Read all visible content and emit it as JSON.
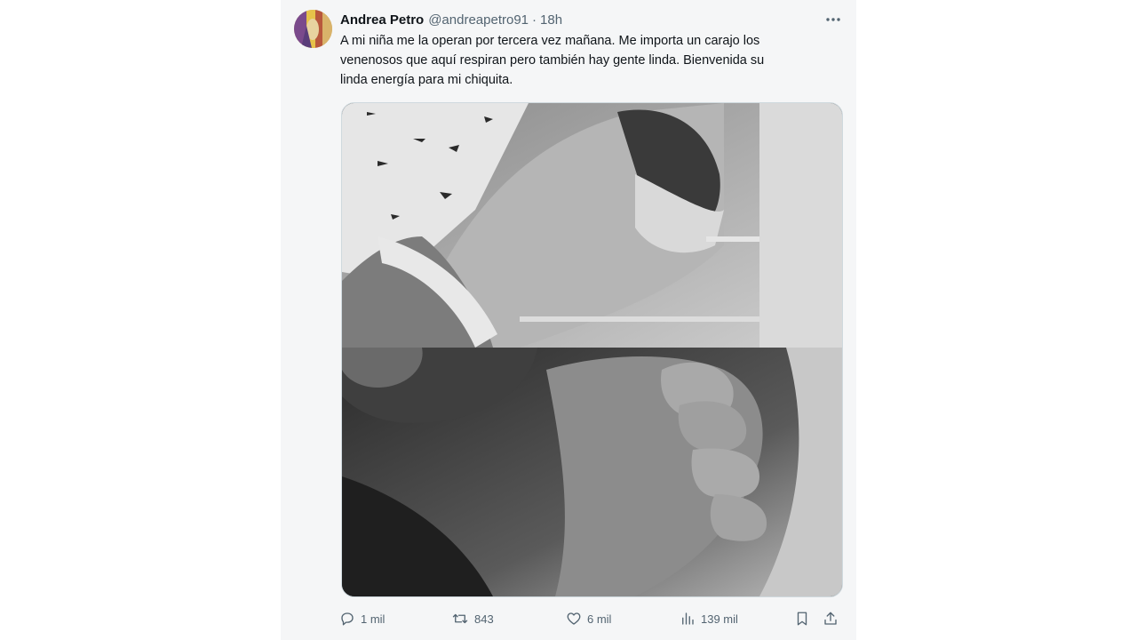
{
  "tweet": {
    "author_name": "Andrea Petro",
    "author_handle": "@andreapetro91",
    "separator": "·",
    "time": "18h",
    "text_lines": [
      "A mi niña me la operan por tercera vez mañana. Me importa un carajo  los",
      "venenosos que aquí respiran pero también hay gente linda. Bienvenida su",
      "linda energía para mi chiquita."
    ]
  },
  "actions": {
    "replies": "1 mil",
    "retweets": "843",
    "likes": "6 mil",
    "views": "139 mil"
  },
  "icons": {
    "more": "more-horizontal-icon",
    "reply": "reply-icon",
    "retweet": "retweet-icon",
    "like": "heart-icon",
    "views": "views-chart-icon",
    "bookmark": "bookmark-icon",
    "share": "share-icon"
  },
  "colors": {
    "text": "#0f1419",
    "muted": "#536471",
    "card_bg": "#f5f6f7"
  }
}
